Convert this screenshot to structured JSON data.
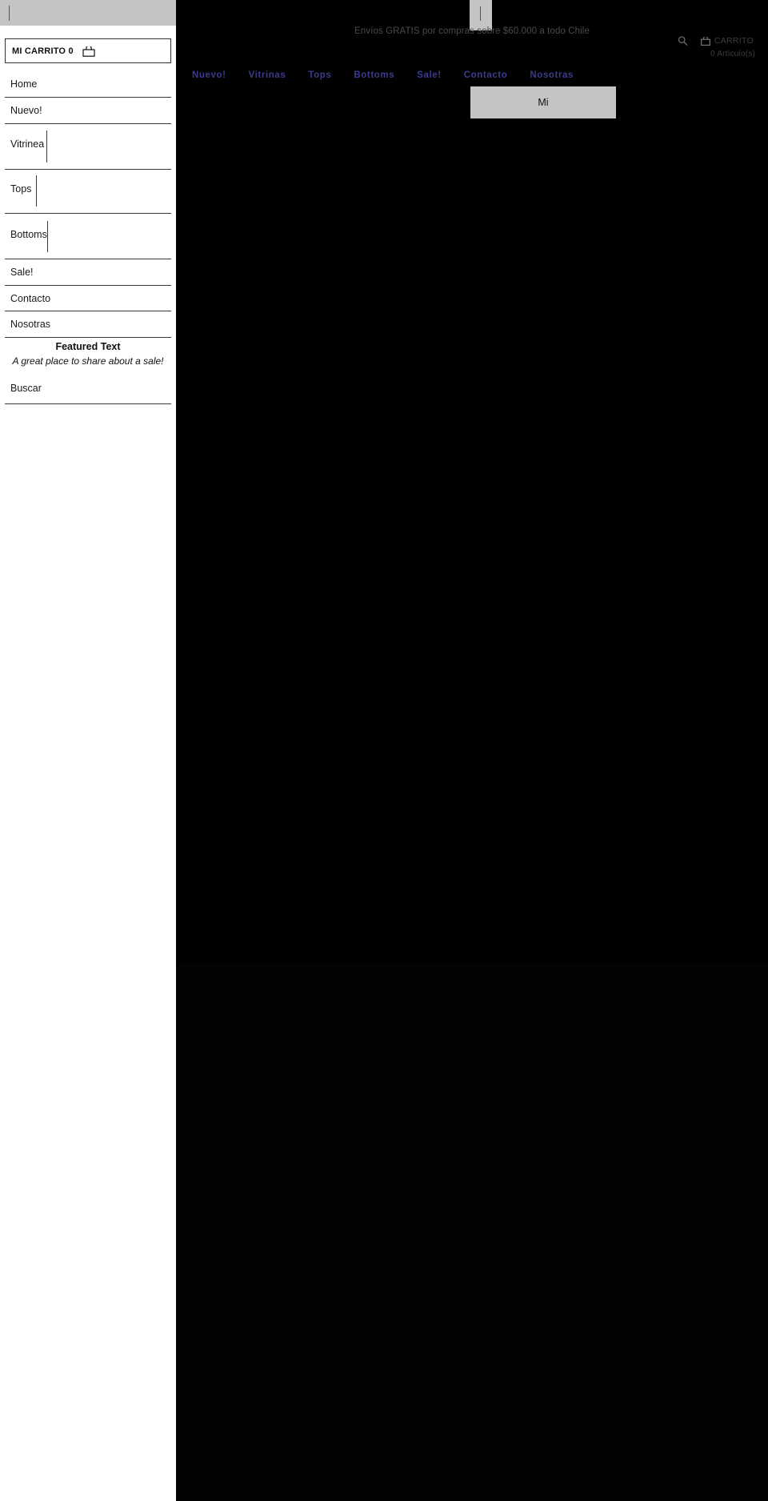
{
  "mobile_menu": {
    "collapse_caret": "|",
    "cart": {
      "label": "MI CARRITO 0",
      "icon": "shopping-bag-icon"
    },
    "items": [
      {
        "label": "Home",
        "has_submenu": false
      },
      {
        "label": "Nuevo!",
        "has_submenu": false
      },
      {
        "label": "Vitrinea",
        "has_submenu": true
      },
      {
        "label": "Tops",
        "has_submenu": true
      },
      {
        "label": "Bottoms",
        "has_submenu": true
      },
      {
        "label": "Sale!",
        "has_submenu": false
      },
      {
        "label": "Contacto",
        "has_submenu": false
      },
      {
        "label": "Nosotras",
        "has_submenu": false
      }
    ],
    "featured": {
      "title": "Featured Text",
      "subtitle": "A great place to share about a sale!"
    },
    "search": {
      "label": "Buscar"
    }
  },
  "site": {
    "menu_tab_caret": "|",
    "promo_banner": "Envíos GRATIS por compras sobre $60.000 a todo Chile",
    "utility": {
      "search_icon": "search-icon",
      "cart_icon": "shopping-bag-icon",
      "cart_label": "CARRITO",
      "items_count": "0 Artículo(s)"
    },
    "nav": [
      {
        "label": "Nuevo!"
      },
      {
        "label": "Vitrinas"
      },
      {
        "label": "Tops"
      },
      {
        "label": "Bottoms"
      },
      {
        "label": "Sale!"
      },
      {
        "label": "Contacto"
      },
      {
        "label": "Nosotras"
      }
    ],
    "account_box": {
      "label": "Mi"
    }
  },
  "colors": {
    "nav_link": "#3b3b8f",
    "panel_gray": "#c4c4c4",
    "page_black": "#000000",
    "banner_text": "#4a4a4a"
  }
}
